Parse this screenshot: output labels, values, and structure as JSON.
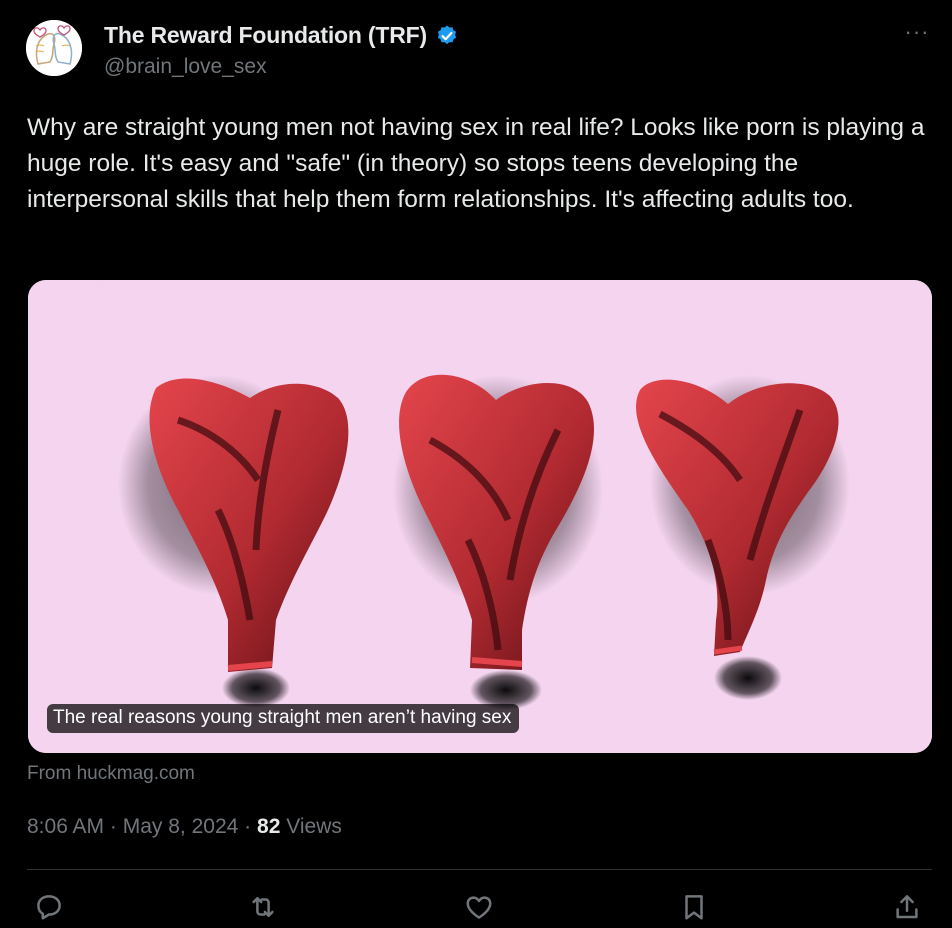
{
  "author": {
    "display_name": "The Reward Foundation (TRF)",
    "handle": "@brain_love_sex",
    "verified": true,
    "verified_color": "#1d9bf0"
  },
  "tweet": {
    "text": "Why are straight young men not having sex in real life? Looks like porn is playing a huge role. It's easy and \"safe\" (in theory) so stops teens developing the interpersonal skills that help them form relationships. It's affecting adults too."
  },
  "card": {
    "caption": "The real reasons young straight men aren’t having sex",
    "source": "From huckmag.com",
    "image_subject": "three deflated red heart-shaped balloons on a pink speckled background",
    "background_color": "#f4d4ef",
    "balloon_color": "#d9383f"
  },
  "meta": {
    "time": "8:06 AM",
    "separator": "·",
    "date": "May 8, 2024",
    "views_count": "82",
    "views_label": "Views"
  },
  "actions": [
    {
      "name": "reply-icon"
    },
    {
      "name": "retweet-icon"
    },
    {
      "name": "like-icon"
    },
    {
      "name": "bookmark-icon"
    },
    {
      "name": "share-icon"
    }
  ],
  "more_icon": "more-horizontal-icon"
}
